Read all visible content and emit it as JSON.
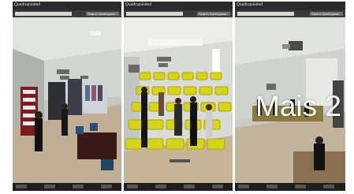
{
  "panels": [
    {
      "title": "Quadrupulated",
      "search_label": "Search Sardingame"
    },
    {
      "title": "Quadrupulated",
      "search_label": "Search Sardingame"
    },
    {
      "title": "Quadrupulated",
      "search_label": "Search Sardingame"
    }
  ],
  "overlay": {
    "text": "Mais 2"
  },
  "colors": {
    "seat_yellow": "#d7d21a",
    "ui_bar": "#2a2a2a",
    "wall": "#d8dad6",
    "floor": "#c9b89a"
  }
}
